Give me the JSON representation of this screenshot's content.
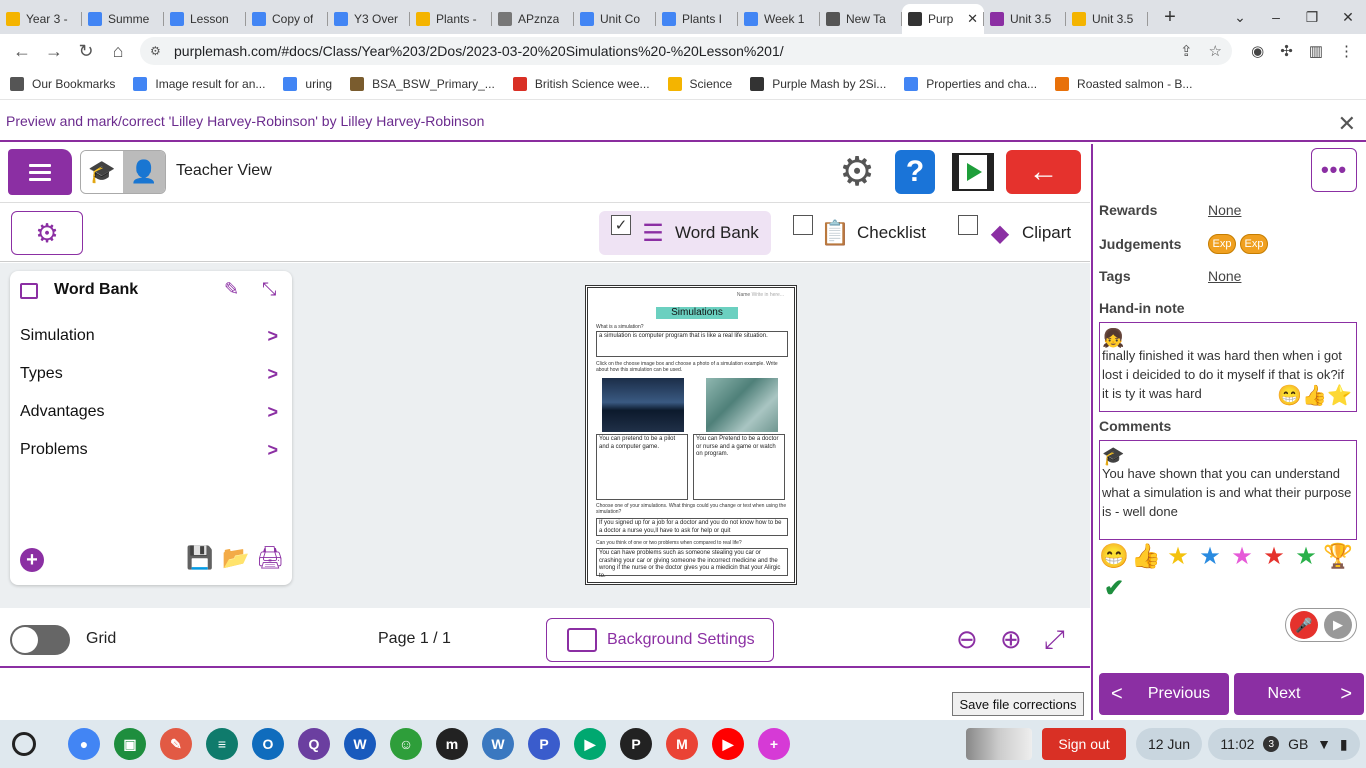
{
  "browser": {
    "tabs": [
      {
        "label": "Year 3 -",
        "color": "#f4b400"
      },
      {
        "label": "Summe",
        "color": "#4285f4"
      },
      {
        "label": "Lesson",
        "color": "#4285f4"
      },
      {
        "label": "Copy of",
        "color": "#4285f4"
      },
      {
        "label": "Y3 Over",
        "color": "#4285f4"
      },
      {
        "label": "Plants -",
        "color": "#f4b400"
      },
      {
        "label": "APznza",
        "color": "#777777"
      },
      {
        "label": "Unit Co",
        "color": "#4285f4"
      },
      {
        "label": "Plants I",
        "color": "#4285f4"
      },
      {
        "label": "Week 1",
        "color": "#4285f4"
      },
      {
        "label": "New Ta",
        "color": "#555555"
      },
      {
        "label": "Purp",
        "color": "#333333"
      },
      {
        "label": "Unit 3.5",
        "color": "#8b2fa3"
      },
      {
        "label": "Unit 3.5",
        "color": "#f4b400"
      }
    ],
    "url": "purplemash.com/#docs/Class/Year%203/2Dos/2023-03-20%20Simulations%20-%20Lesson%201/",
    "bookmarks": [
      {
        "label": "Our Bookmarks",
        "color": "#555555"
      },
      {
        "label": "Image result for an...",
        "color": "#4285f4"
      },
      {
        "label": "uring",
        "color": "#4285f4"
      },
      {
        "label": "BSA_BSW_Primary_...",
        "color": "#7a5c2e"
      },
      {
        "label": "British Science wee...",
        "color": "#d93025"
      },
      {
        "label": "Science",
        "color": "#f4b400"
      },
      {
        "label": "Purple Mash by 2Si...",
        "color": "#333333"
      },
      {
        "label": "Properties and cha...",
        "color": "#4285f4"
      },
      {
        "label": "Roasted salmon - B...",
        "color": "#e8710a"
      }
    ]
  },
  "preview": {
    "title": "Preview and mark/correct 'Lilley Harvey-Robinson' by Lilley Harvey-Robinson"
  },
  "header": {
    "view_label": "Teacher View"
  },
  "tools": {
    "word_bank": "Word Bank",
    "checklist": "Checklist",
    "clipart": "Clipart"
  },
  "word_bank": {
    "title": "Word Bank",
    "items": [
      "Simulation",
      "Types",
      "Advantages",
      "Problems"
    ]
  },
  "worksheet": {
    "name_label": "Name",
    "name_placeholder": "Write in here...",
    "title": "Simulations",
    "q1": "What is a simulation?",
    "a1": "a simulation is computer program that is like a real life situation.",
    "q2": "Click on the choose image box and choose a photo of a simulation example. Write about how this simulation can be used.",
    "box1": "You can pretend to be a pilot and a computer game.",
    "box2": "You can Pretend to be a doctor or nurse and a game or watch on program.",
    "q3": "Choose one of your simulations. What things could you change or test when using the simulation?",
    "a3": "If you signed up for a job for a doctor and you do not know how to be a doctor a nurse you,ll have to ask for help or quit",
    "q4": "Can you think of one or two problems when compared to real life?",
    "a4": "You can have problems such as someone stealing you car or crashing your car or giving someone the incorrect medicine and the wrong if the nurse or the doctor gives you a miedicin that your Alirgic to."
  },
  "bottom": {
    "grid_label": "Grid",
    "page_label": "Page 1 / 1",
    "bg_settings": "Background Settings",
    "save_corrections": "Save file corrections"
  },
  "panel": {
    "rewards_label": "Rewards",
    "rewards_value": "None",
    "judgements_label": "Judgements",
    "judgements": [
      "Exp",
      "Exp"
    ],
    "tags_label": "Tags",
    "tags_value": "None",
    "handin_label": "Hand-in note",
    "handin_text": "finally finished it was hard then when i got lost i deicided to do it myself if that is ok?if it is ty it was hard",
    "comments_label": "Comments",
    "comments_text": "You have shown that you can understand what a simulation is and what their purpose is - well done",
    "previous": "Previous",
    "next": "Next"
  },
  "taskbar": {
    "signout": "Sign out",
    "date": "12 Jun",
    "time": "11:02",
    "notifications": "3",
    "locale": "GB",
    "apps": [
      {
        "name": "chrome",
        "color": "#4285f4",
        "glyph": "●"
      },
      {
        "name": "classroom",
        "color": "#1e8e3e",
        "glyph": "▣"
      },
      {
        "name": "paint",
        "color": "#e25a44",
        "glyph": "✎"
      },
      {
        "name": "forms",
        "color": "#0f7b6c",
        "glyph": "≡"
      },
      {
        "name": "outlook",
        "color": "#0f6cbd",
        "glyph": "O"
      },
      {
        "name": "chat",
        "color": "#6b3fa0",
        "glyph": "Q"
      },
      {
        "name": "word",
        "color": "#185abd",
        "glyph": "W"
      },
      {
        "name": "game",
        "color": "#2e9e3a",
        "glyph": "☺"
      },
      {
        "name": "mash",
        "color": "#222222",
        "glyph": "m"
      },
      {
        "name": "wordpress",
        "color": "#3a78c0",
        "glyph": "W"
      },
      {
        "name": "p-app",
        "color": "#3a5ccc",
        "glyph": "P"
      },
      {
        "name": "play",
        "color": "#00a870",
        "glyph": "▶"
      },
      {
        "name": "pixel",
        "color": "#222222",
        "glyph": "P"
      },
      {
        "name": "gmail",
        "color": "#ea4335",
        "glyph": "M"
      },
      {
        "name": "youtube",
        "color": "#ff0000",
        "glyph": "▶"
      },
      {
        "name": "keep",
        "color": "#d63ad6",
        "glyph": "+"
      }
    ]
  }
}
